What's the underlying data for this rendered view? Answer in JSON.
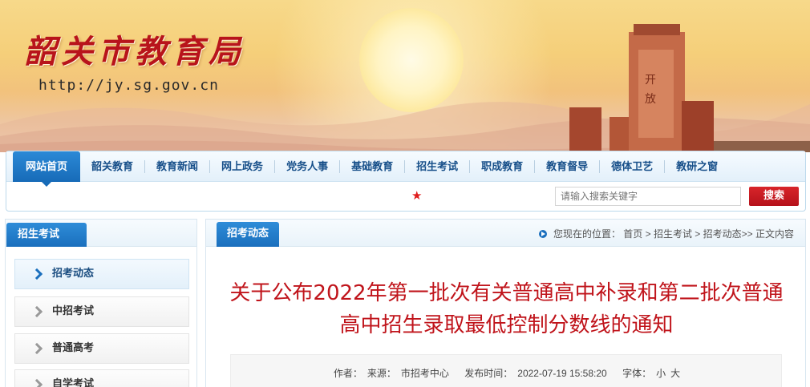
{
  "banner": {
    "site_title": "韶关市教育局",
    "site_url": "http://jy.sg.gov.cn"
  },
  "nav": {
    "items": [
      {
        "label": "网站首页",
        "active": true
      },
      {
        "label": "韶关教育"
      },
      {
        "label": "教育新闻"
      },
      {
        "label": "网上政务"
      },
      {
        "label": "党务人事"
      },
      {
        "label": "基础教育"
      },
      {
        "label": "招生考试"
      },
      {
        "label": "职成教育"
      },
      {
        "label": "教育督导"
      },
      {
        "label": "德体卫艺"
      },
      {
        "label": "教研之窗"
      }
    ]
  },
  "search": {
    "placeholder": "请输入搜索关键字",
    "button_label": "搜索"
  },
  "sidebar": {
    "title": "招生考试",
    "items": [
      {
        "label": "招考动态",
        "active": true
      },
      {
        "label": "中招考试"
      },
      {
        "label": "普通高考"
      },
      {
        "label": "自学考试"
      }
    ]
  },
  "main": {
    "tab_label": "招考动态",
    "breadcrumb": "您现在的位置： 首页 > 招生考试 > 招考动态>> 正文内容",
    "title": "关于公布2022年第一批次有关普通高中补录和第二批次普通高中招生录取最低控制分数线的通知",
    "meta": {
      "author_label": "作者：",
      "source_label": "来源：",
      "source": "市招考中心",
      "publish_label": "发布时间：",
      "publish_time": "2022-07-19 15:58:20",
      "font_label": "字体：",
      "font_small": "小",
      "font_large": "大"
    }
  },
  "colors": {
    "nav_blue": "#1a6fbd",
    "title_red": "#c0141b",
    "search_red": "#c81a20"
  }
}
